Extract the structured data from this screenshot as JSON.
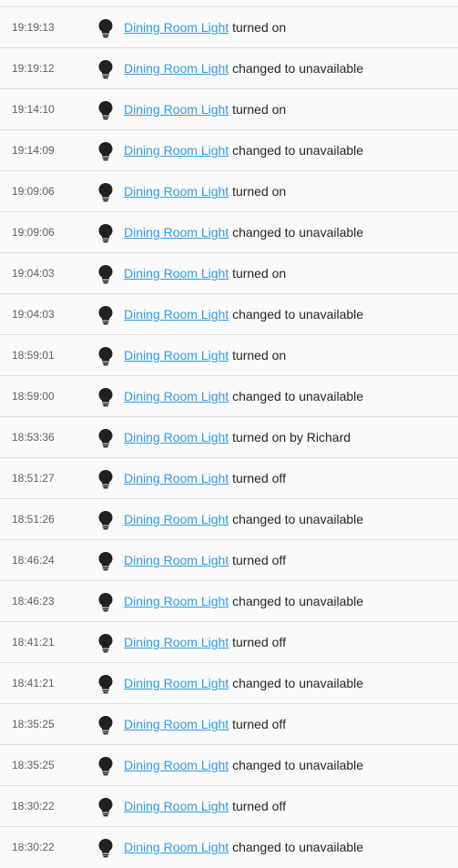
{
  "logbook": {
    "entries": [
      {
        "time": "19:19:13",
        "entity": "Dining Room Light",
        "action": "turned on"
      },
      {
        "time": "19:19:12",
        "entity": "Dining Room Light",
        "action": "changed to unavailable"
      },
      {
        "time": "19:14:10",
        "entity": "Dining Room Light",
        "action": "turned on"
      },
      {
        "time": "19:14:09",
        "entity": "Dining Room Light",
        "action": "changed to unavailable"
      },
      {
        "time": "19:09:06",
        "entity": "Dining Room Light",
        "action": "turned on"
      },
      {
        "time": "19:09:06",
        "entity": "Dining Room Light",
        "action": "changed to unavailable"
      },
      {
        "time": "19:04:03",
        "entity": "Dining Room Light",
        "action": "turned on"
      },
      {
        "time": "19:04:03",
        "entity": "Dining Room Light",
        "action": "changed to unavailable"
      },
      {
        "time": "18:59:01",
        "entity": "Dining Room Light",
        "action": "turned on"
      },
      {
        "time": "18:59:00",
        "entity": "Dining Room Light",
        "action": "changed to unavailable"
      },
      {
        "time": "18:53:36",
        "entity": "Dining Room Light",
        "action": "turned on by Richard"
      },
      {
        "time": "18:51:27",
        "entity": "Dining Room Light",
        "action": "turned off"
      },
      {
        "time": "18:51:26",
        "entity": "Dining Room Light",
        "action": "changed to unavailable"
      },
      {
        "time": "18:46:24",
        "entity": "Dining Room Light",
        "action": "turned off"
      },
      {
        "time": "18:46:23",
        "entity": "Dining Room Light",
        "action": "changed to unavailable"
      },
      {
        "time": "18:41:21",
        "entity": "Dining Room Light",
        "action": "turned off"
      },
      {
        "time": "18:41:21",
        "entity": "Dining Room Light",
        "action": "changed to unavailable"
      },
      {
        "time": "18:35:25",
        "entity": "Dining Room Light",
        "action": "turned off"
      },
      {
        "time": "18:35:25",
        "entity": "Dining Room Light",
        "action": "changed to unavailable"
      },
      {
        "time": "18:30:22",
        "entity": "Dining Room Light",
        "action": "turned off"
      },
      {
        "time": "18:30:22",
        "entity": "Dining Room Light",
        "action": "changed to unavailable"
      }
    ]
  },
  "icons": {
    "entry_icon": "lightbulb-icon"
  },
  "colors": {
    "link": "#2e9be6",
    "text": "#262626",
    "time": "#5f5f5f",
    "divider": "#dedede",
    "icon": "#212121"
  }
}
